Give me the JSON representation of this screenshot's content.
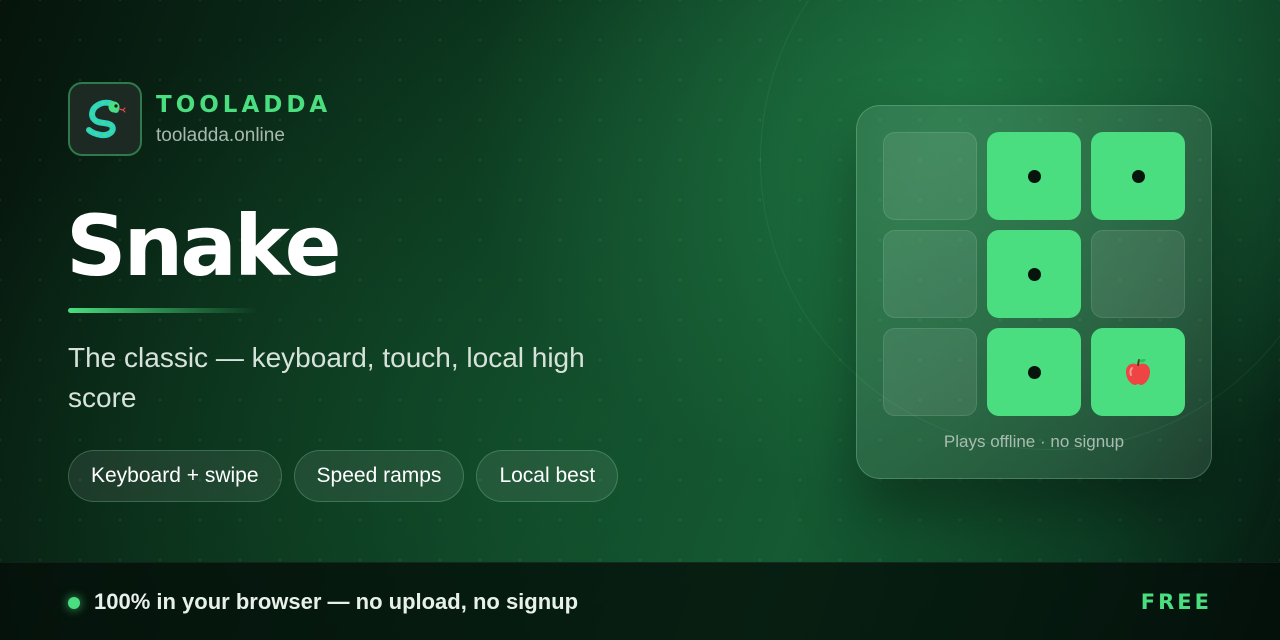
{
  "brand": {
    "name": "TOOLADDA",
    "url": "tooladda.online",
    "logo_icon": "snake-icon"
  },
  "hero": {
    "title": "Snake",
    "subtitle": "The classic — keyboard, touch, local high score"
  },
  "chips": [
    {
      "label": "Keyboard + swipe"
    },
    {
      "label": "Speed ramps"
    },
    {
      "label": "Local best"
    }
  ],
  "preview": {
    "caption": "Plays offline · no signup",
    "cells": [
      "empty",
      "snake",
      "snake",
      "empty",
      "snake",
      "empty",
      "empty",
      "snake",
      "apple"
    ],
    "apple_icon": "apple-icon"
  },
  "footer": {
    "text": "100% in your browser — no upload, no signup",
    "badge": "FREE"
  },
  "colors": {
    "accent": "#4ade80",
    "background_dark": "#06140c",
    "apple": "#ef4444"
  }
}
